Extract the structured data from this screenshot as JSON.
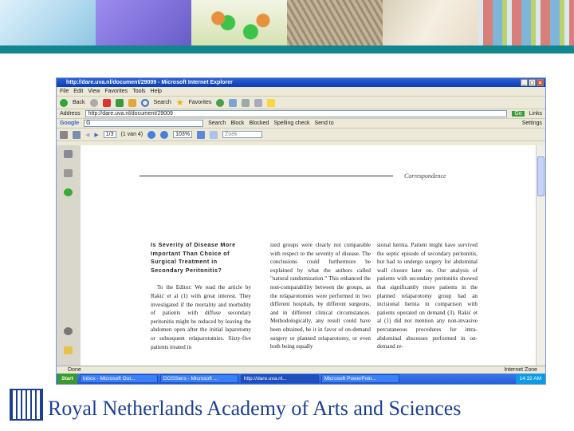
{
  "slide": {
    "footer": "Royal Netherlands Academy of Arts and Sciences",
    "banner_colors": [
      "#a9d3ea",
      "#8c7fe0",
      "#dfe8c8",
      "#b8a990",
      "#e9e2cf",
      "#c9a7a0"
    ],
    "band_color": "#12868f"
  },
  "browser": {
    "title": "http://dare.uva.nl/document/29009 - Microsoft Internet Explorer",
    "menu": [
      "File",
      "Edit",
      "View",
      "Favorites",
      "Tools",
      "Help"
    ],
    "toolbar": {
      "back": "Back",
      "search": "Search",
      "favorites": "Favorites"
    },
    "address": {
      "label": "Address",
      "value": "http://dare.uva.nl/document/29009",
      "go": "Go",
      "links": "Links"
    },
    "google": {
      "label": "Google",
      "query": "G",
      "buttons": [
        "Search",
        "Block",
        "Blocked",
        "Spelling check",
        "Send to",
        "Settings"
      ]
    },
    "pdf": {
      "page": "1/3",
      "of": "(1 van 4)",
      "zoom": "103%",
      "find": "Zoek"
    },
    "status": "Done",
    "zone": "Internet Zone"
  },
  "document": {
    "section": "Correspondence",
    "heading": "Is Severity of Disease More Important Than Choice of Surgical Treatment in Secondary Peritonitis?",
    "col1": "To the Editor: We read the article by Rakić et al (1) with great interest. They investigated if the mortality and morbidity of patients with diffuse secondary peritonitis might be reduced by leaving the abdomen open after the initial laparotomy or subsequent relaparotomies. Sixty-five patients treated in",
    "col2": "ized groups were clearly not comparable with respect to the severity of disease. The conclusions could furthermore be explained by what the authors called \"natural randomization.\" This enhanced the non-comparability between the groups, as the relaparotomies were performed in two different hospitals, by different surgeons, and in different clinical circumstances. Methodologically, any result could have been obtained, be it in favor of on-demand surgery or planned relaparotomy, or even both being equally",
    "col3": "sional hernia. Patient might have survived the septic episode of secondary peritonitis, but had to undergo surgery for abdominal wall closure later on. Our analysis of patients with secondary peritonitis showed that significantly more patients in the planned relaparotomy group had an incisional hernia in comparison with patients operated on demand (3). Rakić et al (1) did not mention any non-invasive percutaneous procedures for intra-abdominal abscesses performed in on-demand re-"
  },
  "taskbar": {
    "start": "Start",
    "items": [
      "Inbox - Microsoft Out...",
      "DOSSiers - Microsoft ...",
      "http://dare.uva.nl...",
      "Microsoft PowerPoin..."
    ],
    "clock": "14:32 AM"
  }
}
